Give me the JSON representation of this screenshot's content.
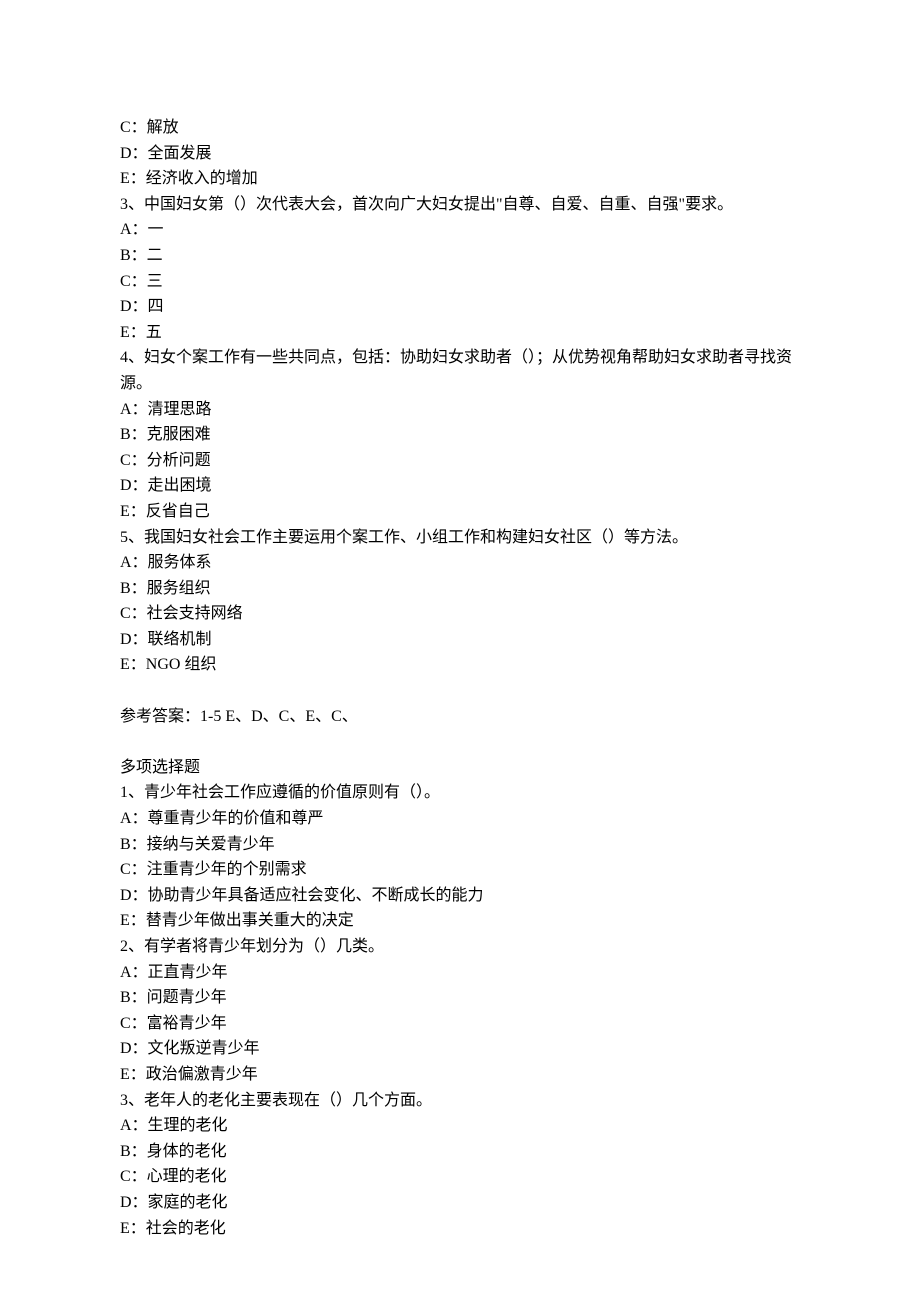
{
  "lines": [
    "C：解放",
    "D：全面发展",
    "E：经济收入的增加",
    "3、中国妇女第（）次代表大会，首次向广大妇女提出\"自尊、自爱、自重、自强\"要求。",
    "A：一",
    "B：二",
    "C：三",
    "D：四",
    "E：五",
    "4、妇女个案工作有一些共同点，包括：协助妇女求助者（）；从优势视角帮助妇女求助者寻找资源。",
    "A：清理思路",
    "B：克服困难",
    "C：分析问题",
    "D：走出困境",
    "E：反省自己",
    "5、我国妇女社会工作主要运用个案工作、小组工作和构建妇女社区（）等方法。",
    "A：服务体系",
    "B：服务组织",
    "C：社会支持网络",
    "D：联络机制",
    "E：NGO 组织",
    "",
    "参考答案：1-5 E、D、C、E、C、",
    "",
    "多项选择题",
    "1、青少年社会工作应遵循的价值原则有（）。",
    "A：尊重青少年的价值和尊严",
    "B：接纳与关爱青少年",
    "C：注重青少年的个别需求",
    "D：协助青少年具备适应社会变化、不断成长的能力",
    "E：替青少年做出事关重大的决定",
    "2、有学者将青少年划分为（）几类。",
    "A：正直青少年",
    "B：问题青少年",
    "C：富裕青少年",
    "D：文化叛逆青少年",
    "E：政治偏激青少年",
    "3、老年人的老化主要表现在（）几个方面。",
    "A：生理的老化",
    "B：身体的老化",
    "C：心理的老化",
    "D：家庭的老化",
    "E：社会的老化"
  ]
}
